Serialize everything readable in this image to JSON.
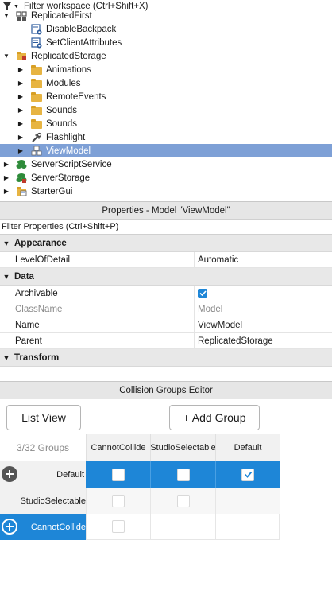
{
  "explorer": {
    "filter_placeholder": "Filter workspace (Ctrl+Shift+X)",
    "items": [
      {
        "label": "ReplicatedFirst",
        "icon": "replicated-first-icon"
      },
      {
        "label": "DisableBackpack",
        "icon": "local-script-icon"
      },
      {
        "label": "SetClientAttributes",
        "icon": "local-script-icon"
      },
      {
        "label": "ReplicatedStorage",
        "icon": "replicated-storage-icon"
      },
      {
        "label": "Animations",
        "icon": "folder-icon"
      },
      {
        "label": "Modules",
        "icon": "folder-icon"
      },
      {
        "label": "RemoteEvents",
        "icon": "folder-icon"
      },
      {
        "label": "Sounds",
        "icon": "folder-icon"
      },
      {
        "label": "Sounds",
        "icon": "folder-icon"
      },
      {
        "label": "Flashlight",
        "icon": "tool-icon"
      },
      {
        "label": "ViewModel",
        "icon": "model-icon"
      },
      {
        "label": "ServerScriptService",
        "icon": "server-script-service-icon"
      },
      {
        "label": "ServerStorage",
        "icon": "server-storage-icon"
      },
      {
        "label": "StarterGui",
        "icon": "starter-gui-icon"
      }
    ]
  },
  "properties": {
    "title": "Properties - Model \"ViewModel\"",
    "filter_placeholder": "Filter Properties (Ctrl+Shift+P)",
    "categories": {
      "appearance": "Appearance",
      "data": "Data",
      "transform": "Transform"
    },
    "rows": {
      "level_of_detail": {
        "name": "LevelOfDetail",
        "value": "Automatic"
      },
      "archivable": {
        "name": "Archivable",
        "checked": true
      },
      "class_name": {
        "name": "ClassName",
        "value": "Model"
      },
      "name": {
        "name": "Name",
        "value": "ViewModel"
      },
      "parent": {
        "name": "Parent",
        "value": "ReplicatedStorage"
      }
    }
  },
  "collision": {
    "title": "Collision Groups Editor",
    "list_view_label": "List View",
    "add_group_label": "+ Add Group",
    "groups_count": "3/32 Groups",
    "columns": [
      "CannotCollide",
      "StudioSelectable",
      "Default"
    ],
    "rows": [
      {
        "name": "Default"
      },
      {
        "name": "StudioSelectable"
      },
      {
        "name": "CannotCollide"
      }
    ]
  },
  "colors": {
    "selection_explorer": "#7ea0d6",
    "selection_accent": "#1e86d7",
    "folder": "#e7b442"
  }
}
